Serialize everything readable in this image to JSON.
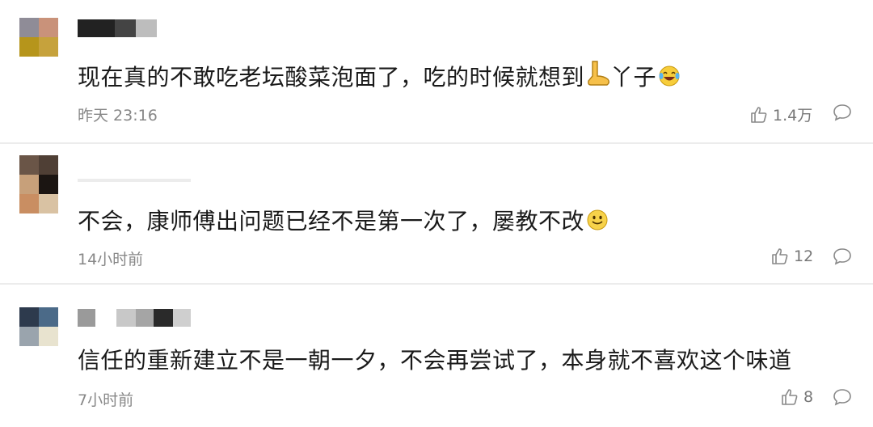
{
  "comments": [
    {
      "text": "现在真的不敢吃老坛酸菜泡面了，吃的时候就想到",
      "text_tail": "丫子",
      "time": "昨天 23:16",
      "likes": "1.4万",
      "avatar_colors": [
        "#8f8c97",
        "#c9927a",
        "#b6951b",
        "#c6a23c"
      ],
      "name_colors": [
        "#222222",
        "#555555",
        "#d9d9d9"
      ],
      "icons": [
        "foot-emoji",
        "laughing-tears-emoji"
      ]
    },
    {
      "text": "不会，康师傅出问题已经不是第一次了，屡教不改",
      "time": "14小时前",
      "likes": "12",
      "avatar_colors": [
        "#6a5547",
        "#4f3f35",
        "#c7a07a",
        "#1b1512"
      ],
      "name_colors": [
        "#e3e3e3",
        "#e8e8e8"
      ],
      "icons": [
        "smile-emoji"
      ]
    },
    {
      "text": "信任的重新建立不是一朝一夕，不会再尝试了，本身就不喜欢这个味道",
      "time": "7小时前",
      "likes": "8",
      "avatar_colors": [
        "#2d3a4d",
        "#4b6a88",
        "#9aa4ad",
        "#e8e3cf"
      ],
      "name_colors": [
        "#9a9a9a",
        "#c8c8c8",
        "#6e6e6e",
        "#2a2a2a",
        "#cfcfcf"
      ],
      "icons": []
    }
  ],
  "icon_names": {
    "like": "thumbs-up-icon",
    "reply": "comment-bubble-icon"
  }
}
